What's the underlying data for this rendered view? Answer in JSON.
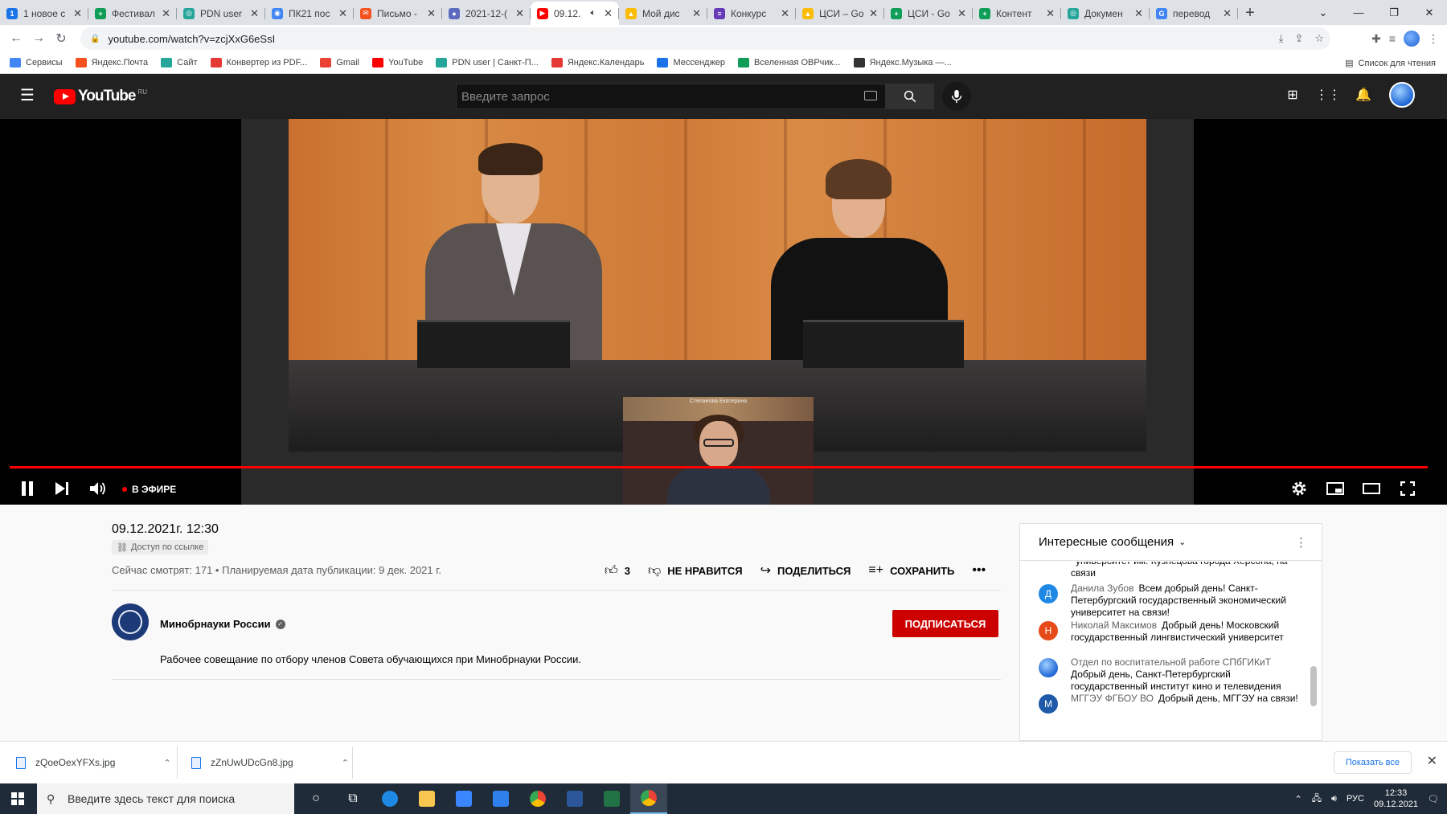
{
  "browser": {
    "tabs": [
      {
        "title": "1 новое с",
        "color": "#1a73e8",
        "letter": "1"
      },
      {
        "title": "Фестивал",
        "color": "#0f9d58",
        "letter": "+"
      },
      {
        "title": "PDN user",
        "color": "#26a69a",
        "letter": "◎"
      },
      {
        "title": "ПК21 пос",
        "color": "#4285f4",
        "letter": "◉"
      },
      {
        "title": "Письмо -",
        "color": "#f4511e",
        "letter": "✉"
      },
      {
        "title": "2021-12-(",
        "color": "#5c6bc0",
        "letter": "●"
      },
      {
        "title": "09.12.",
        "color": "#ff0000",
        "letter": "▶",
        "active": true
      },
      {
        "title": "Мой дис",
        "color": "#fbbc04",
        "letter": "▲"
      },
      {
        "title": "Конкурс",
        "color": "#673ab7",
        "letter": "≡"
      },
      {
        "title": "ЦСИ – Go",
        "color": "#fbbc04",
        "letter": "▲"
      },
      {
        "title": "ЦСИ - Go",
        "color": "#0f9d58",
        "letter": "+"
      },
      {
        "title": "Контент",
        "color": "#0f9d58",
        "letter": "+"
      },
      {
        "title": "Докумен",
        "color": "#26a69a",
        "letter": "◎"
      },
      {
        "title": "перевод",
        "color": "#4285f4",
        "letter": "G"
      }
    ],
    "url": "youtube.com/watch?v=zcjXxG6eSsI",
    "bookmarks": [
      {
        "label": "Сервисы",
        "color": "#4285f4"
      },
      {
        "label": "Яндекс.Почта",
        "color": "#f4511e"
      },
      {
        "label": "Сайт",
        "color": "#26a69a"
      },
      {
        "label": "Конвертер из PDF...",
        "color": "#e53935"
      },
      {
        "label": "Gmail",
        "color": "#ea4335"
      },
      {
        "label": "YouTube",
        "color": "#ff0000"
      },
      {
        "label": "PDN user | Санкт-П...",
        "color": "#26a69a"
      },
      {
        "label": "Яндекс.Календарь",
        "color": "#e53935"
      },
      {
        "label": "Мессенджер",
        "color": "#1a73e8"
      },
      {
        "label": "Вселенная ОВРчик...",
        "color": "#0f9d58"
      },
      {
        "label": "Яндекс.Музыка —...",
        "color": "#333333"
      }
    ],
    "reading_list": "Список для чтения"
  },
  "youtube": {
    "logo_text": "YouTube",
    "region": "RU",
    "search_placeholder": "Введите запрос",
    "live_label": "В ЭФИРЕ",
    "inset_caption": "Степанова Екатерина",
    "video_title": "09.12.2021г. 12:30",
    "access_badge": "Доступ по ссылке",
    "views_line": "Сейчас смотрят: 171 • Планируемая дата публикации: 9 дек. 2021 г.",
    "likes": "3",
    "dislike_label": "НЕ НРАВИТСЯ",
    "share_label": "ПОДЕЛИТЬСЯ",
    "save_label": "СОХРАНИТЬ",
    "channel_name": "Минобрнауки России",
    "subscribe_label": "ПОДПИСАТЬСЯ",
    "description": "Рабочее совещание по отбору членов Совета обучающихся при Минобрнауки России."
  },
  "chat": {
    "header": "Интересные сообщения",
    "messages": [
      {
        "initial": "",
        "color": "#ffffff",
        "author": "",
        "text": "университет им. Кузнецова города Херсона, на связи"
      },
      {
        "initial": "Д",
        "color": "#1e88e5",
        "author": "Данила Зубов",
        "text": "Всем добрый день! Санкт-Петербургский государственный экономический университет на связи!"
      },
      {
        "initial": "Н",
        "color": "#e64a19",
        "author": "Николай Максимов",
        "text": "Добрый день! Московский государственный лингвистический университет"
      },
      {
        "initial": "",
        "color": "#1e66d6",
        "author": "Отдел по воспитательной работе СПбГИКиТ",
        "text": "Добрый день, Санкт-Петербургский государственный институт кино и телевидения"
      },
      {
        "initial": "М",
        "color": "#1e5aa8",
        "author": "МГГЭУ ФГБОУ ВО",
        "text": "Добрый день, МГГЭУ на связи!"
      }
    ]
  },
  "downloads": {
    "files": [
      "zQoeOexYFXs.jpg",
      "zZnUwUDcGn8.jpg"
    ],
    "show_all": "Показать все"
  },
  "taskbar": {
    "search_placeholder": "Введите здесь текст для поиска",
    "lang": "РУС",
    "time": "12:33",
    "date": "09.12.2021"
  }
}
